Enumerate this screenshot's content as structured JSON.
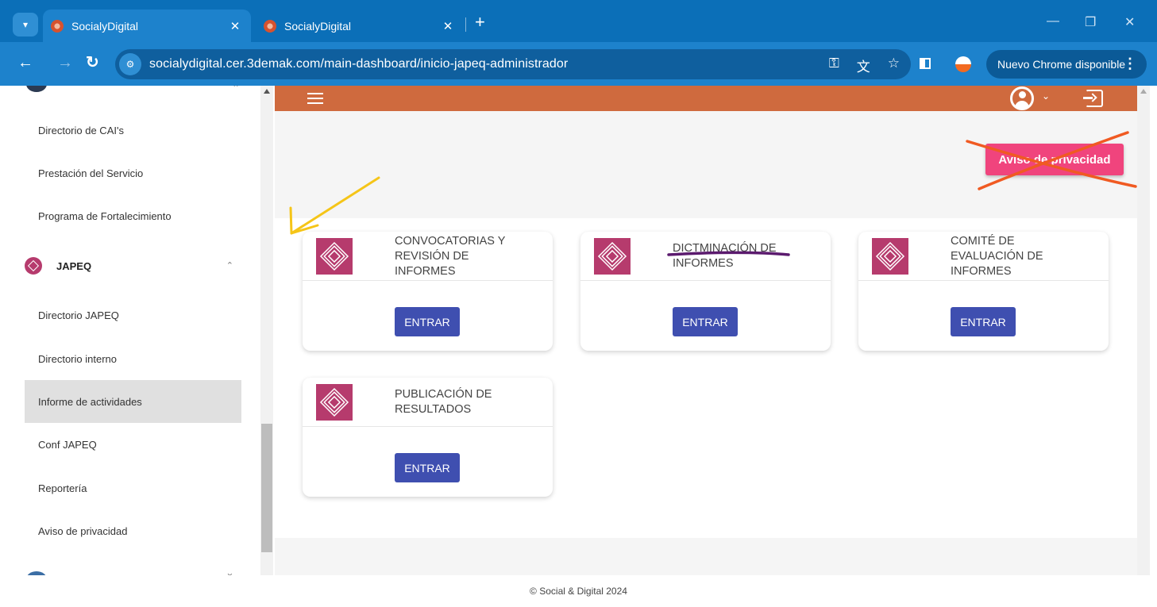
{
  "browser": {
    "tabs": [
      {
        "title": "SocialyDigital",
        "active": true
      },
      {
        "title": "SocialyDigital",
        "active": false
      }
    ],
    "url": "socialydigital.cer.3demak.com/main-dashboard/inicio-japeq-administrador",
    "update_label": "Nuevo Chrome disponible"
  },
  "sidebar": {
    "items_top": [
      {
        "label": "Directorio de CAI's"
      },
      {
        "label": "Prestación del Servicio"
      },
      {
        "label": "Programa de Fortalecimiento"
      }
    ],
    "group": {
      "label": "JAPEQ",
      "expanded": true
    },
    "subitems": [
      {
        "label": "Directorio JAPEQ"
      },
      {
        "label": "Directorio interno"
      },
      {
        "label": "Informe de actividades",
        "active": true
      },
      {
        "label": "Conf JAPEQ"
      },
      {
        "label": "Reportería"
      },
      {
        "label": "Aviso de privacidad"
      }
    ]
  },
  "header": {
    "privacy_button": "Aviso de privacidad"
  },
  "cards": [
    {
      "title": "CONVOCATORIAS Y REVISIÓN DE INFORMES",
      "button": "ENTRAR"
    },
    {
      "title": "DICTMINACIÓN DE INFORMES",
      "button": "ENTRAR"
    },
    {
      "title": "COMITÉ DE EVALUACIÓN DE INFORMES",
      "button": "ENTRAR"
    },
    {
      "title": "PUBLICACIÓN DE RESULTADOS",
      "button": "ENTRAR"
    }
  ],
  "footer": {
    "text": "© Social & Digital 2024"
  },
  "colors": {
    "topbar": "#cf6a3e",
    "accent_button": "#3f4fb0",
    "privacy_button": "#f0447d",
    "logo": "#b63b6d",
    "browser_blue": "#1d82cc"
  },
  "icons": [
    "tab-search-icon",
    "favicon-icon",
    "close-icon",
    "new-tab-icon",
    "back-icon",
    "forward-icon",
    "reload-icon",
    "site-info-icon",
    "password-key-icon",
    "translate-icon",
    "bookmark-star-icon",
    "side-panel-icon",
    "profile-icon",
    "kebab-menu-icon",
    "hamburger-icon",
    "user-account-icon",
    "logout-icon"
  ]
}
